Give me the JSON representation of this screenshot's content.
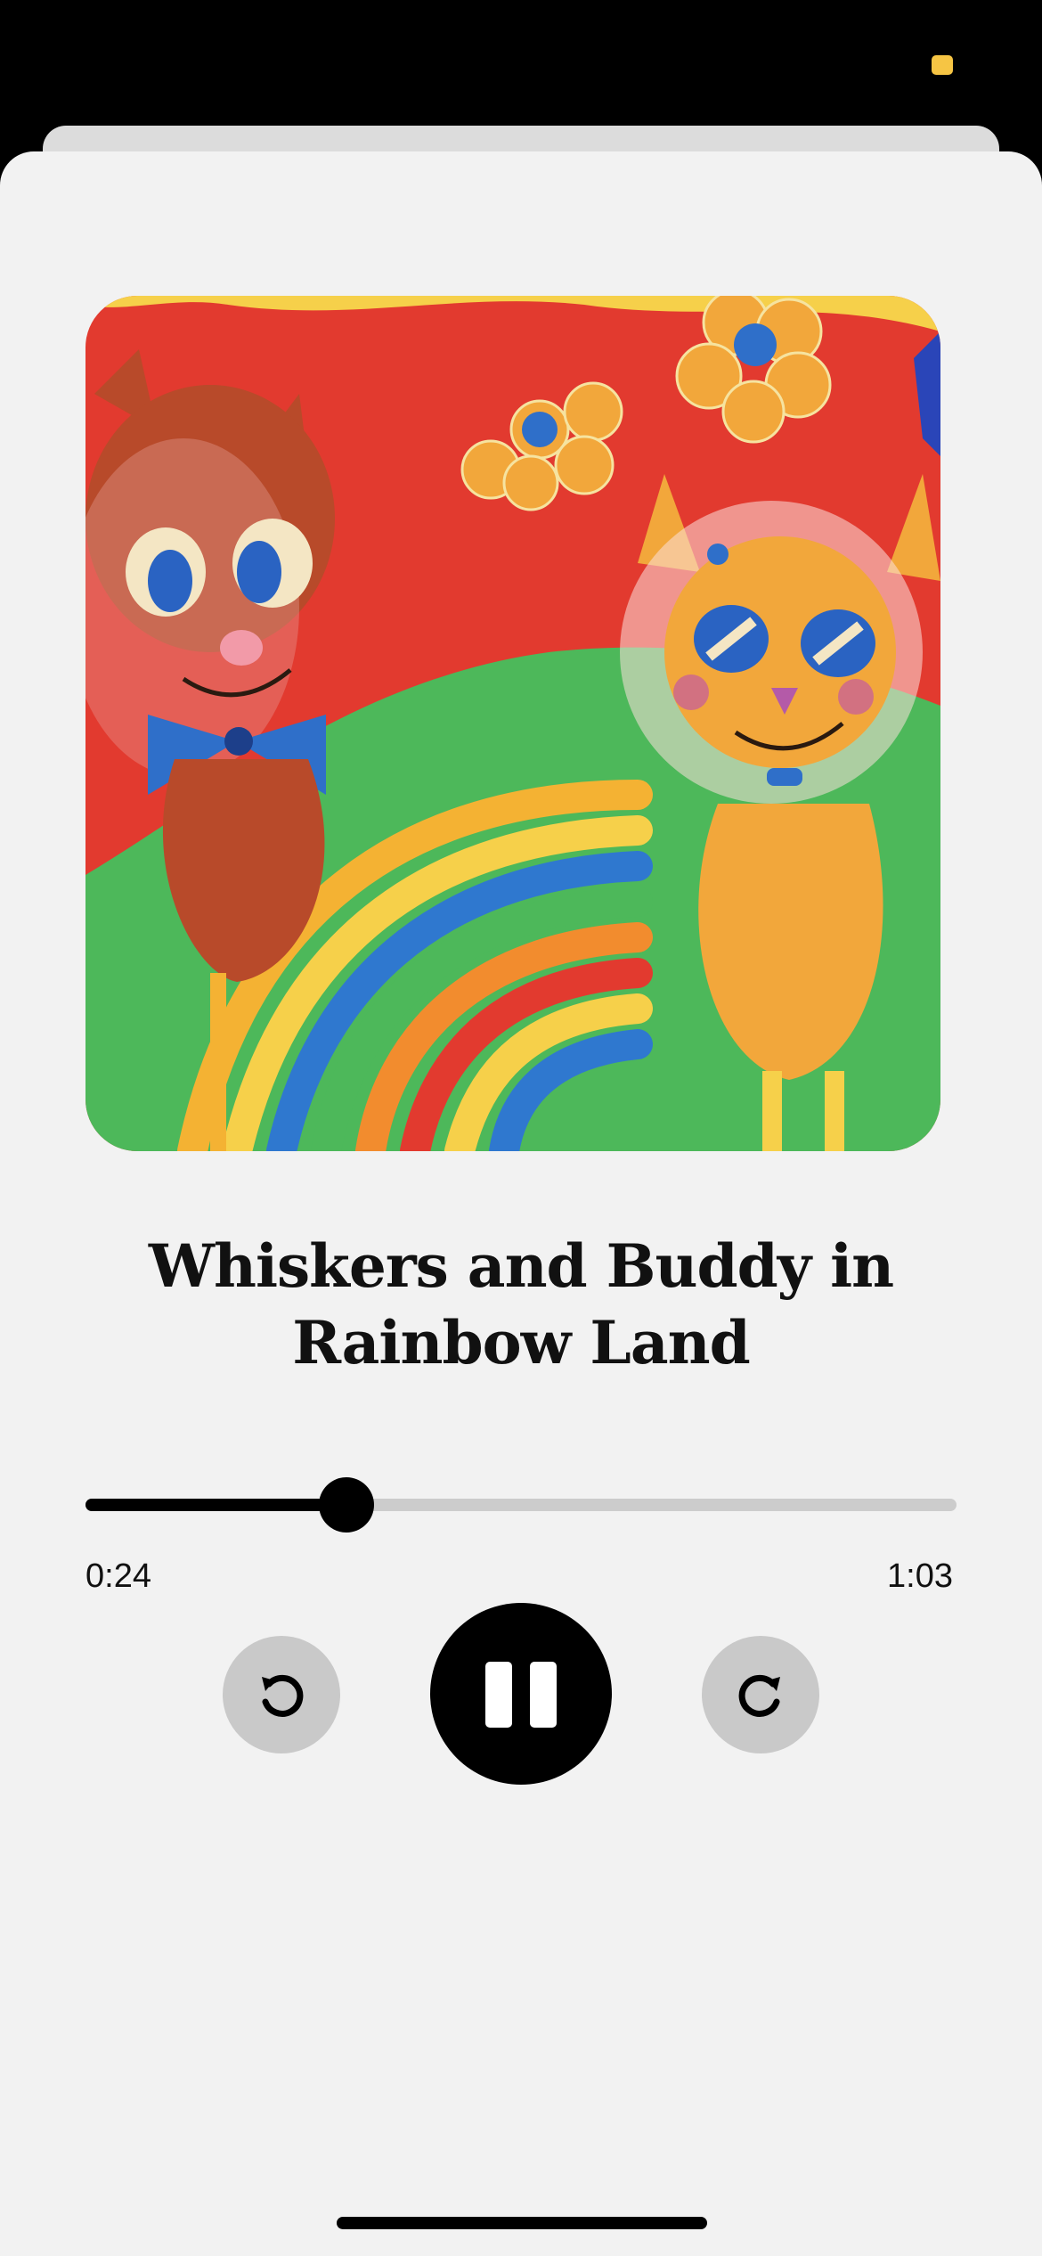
{
  "player": {
    "story_title": "Whiskers and Buddy in Rainbow Land",
    "artwork_icon": "cats-in-rainbow-land-illustration",
    "progress_fraction": 0.3,
    "elapsed_time": "0:24",
    "total_time": "1:03",
    "rewind_icon": "rewind-icon",
    "pause_icon": "pause-icon",
    "forward_icon": "forward-icon",
    "colors": {
      "background": "#f2f2f2",
      "accent": "#000000",
      "track": "#cccccc",
      "secondary_button": "#c9c9c9",
      "status_indicator": "#f6c544"
    }
  }
}
